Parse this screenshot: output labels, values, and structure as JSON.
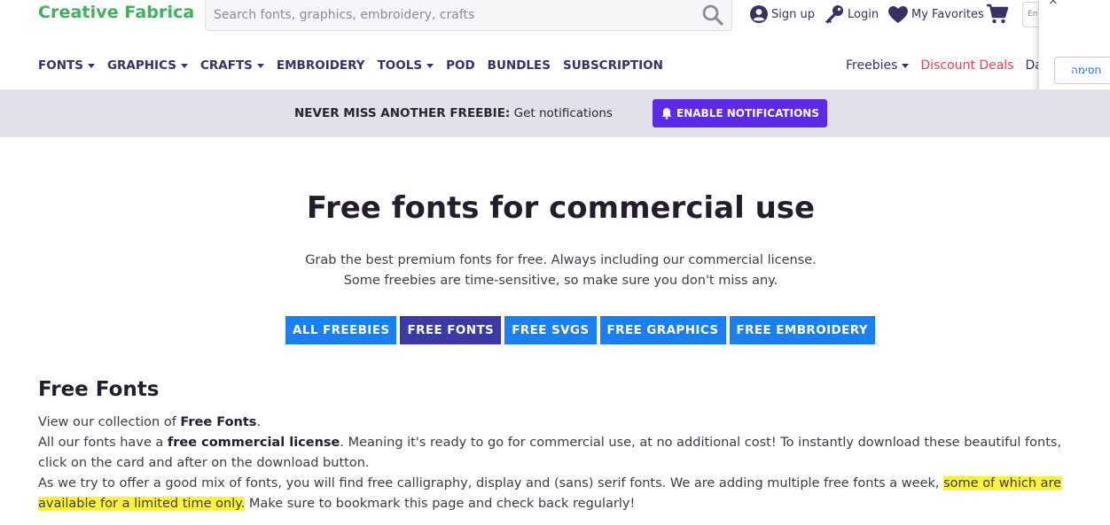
{
  "brand": {
    "name": "Creative Fabrica"
  },
  "search": {
    "placeholder": "Search fonts, graphics, embroidery, crafts"
  },
  "account": {
    "signup": "Sign up",
    "login": "Login",
    "favorites": "My Favorites"
  },
  "lang": {
    "label": "En"
  },
  "nav": {
    "items": [
      {
        "label": "FONTS",
        "dropdown": true
      },
      {
        "label": "GRAPHICS",
        "dropdown": true
      },
      {
        "label": "CRAFTS",
        "dropdown": true
      },
      {
        "label": "EMBROIDERY",
        "dropdown": false
      },
      {
        "label": "TOOLS",
        "dropdown": true
      },
      {
        "label": "POD",
        "dropdown": false
      },
      {
        "label": "BUNDLES",
        "dropdown": false
      },
      {
        "label": "SUBSCRIPTION",
        "dropdown": false
      }
    ],
    "right": {
      "freebies": "Freebies",
      "deals": "Discount Deals",
      "da": "Da"
    }
  },
  "popup": {
    "close": "×",
    "button": "חסימה"
  },
  "notify": {
    "bold": "NEVER MISS ANOTHER FREEBIE:",
    "text": " Get notifications",
    "button": "ENABLE NOTIFICATIONS"
  },
  "hero": {
    "title": "Free fonts for commercial use",
    "line1": "Grab the best premium fonts for free. Always including our commercial license.",
    "line2": "Some freebies are time-sensitive, so make sure you don't miss any."
  },
  "tabs": [
    {
      "label": "ALL FREEBIES",
      "active": false
    },
    {
      "label": "FREE FONTS",
      "active": true
    },
    {
      "label": "FREE SVGS",
      "active": false
    },
    {
      "label": "FREE GRAPHICS",
      "active": false
    },
    {
      "label": "FREE EMBROIDERY",
      "active": false
    }
  ],
  "content": {
    "title": "Free Fonts",
    "p1_pre": "View our collection of ",
    "p1_bold": "Free Fonts",
    "p1_post": ".",
    "p2_pre": "All our fonts have a ",
    "p2_bold": "free commercial license",
    "p2_post": ". Meaning it's ready to go for commercial use, at no additional cost! To instantly download these beautiful fonts, click on the card and after on the download button.",
    "p3_pre": "As we try to offer a good mix of fonts, you will find free calligraphy, display and (sans) serif fonts. We are adding multiple free fonts a week, ",
    "p3_highlight": "some of which are available for a limited time only.",
    "p3_post": " Make sure to bookmark this page and check back regularly!"
  },
  "colors": {
    "brand_green": "#3cb35a",
    "nav_purple": "#3b2f66",
    "deals_red": "#e2455a",
    "notify_button": "#5b2be8",
    "tab_blue": "#1a7ff0",
    "tab_active": "#3a39a5",
    "highlight": "#fbf23a"
  }
}
